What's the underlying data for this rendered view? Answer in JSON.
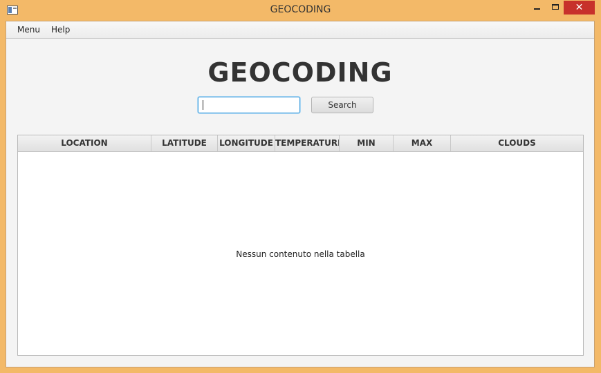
{
  "window": {
    "title": "GEOCODING",
    "minimize_label": "",
    "maximize_label": "",
    "close_label": "✕"
  },
  "menubar": {
    "items": [
      {
        "label": "Menu"
      },
      {
        "label": "Help"
      }
    ]
  },
  "main": {
    "heading": "GEOCODING",
    "search": {
      "value": "",
      "placeholder": "",
      "button_label": "Search"
    },
    "table": {
      "columns": [
        "LOCATION",
        "LATITUDE",
        "LONGITUDE",
        "TEMPERATURE",
        "MIN",
        "MAX",
        "CLOUDS"
      ],
      "rows": [],
      "empty_message": "Nessun contenuto nella tabella"
    }
  },
  "colors": {
    "window_frame": "#f3b968",
    "close_button": "#c7312b",
    "focus_border": "#3a9bdc"
  }
}
